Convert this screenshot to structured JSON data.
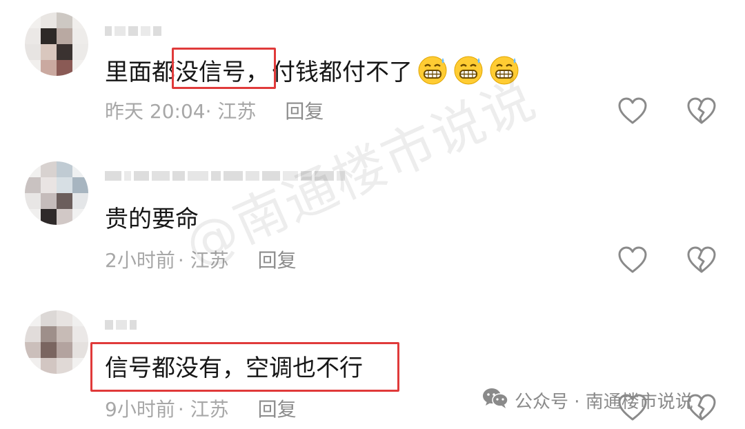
{
  "comments": [
    {
      "text_before": "里面都",
      "text_highlight": "没信号，",
      "text_after": "付钱都付不了",
      "emoji": [
        "grimacing-sweat-emoji",
        "grimacing-sweat-emoji",
        "grimacing-sweat-emoji"
      ],
      "time": "昨天 20:04",
      "location": "· 江苏",
      "reply": "回复"
    },
    {
      "text_before": "贵的要命",
      "time": "2小时前",
      "location": "· 江苏",
      "reply": "回复"
    },
    {
      "text_highlight": "信号都没有，空调也不行",
      "time": "9小时前",
      "location": "· 江苏",
      "reply": "回复"
    }
  ],
  "watermark": "@南通楼市说说",
  "source": {
    "icon": "wechat-icon",
    "label": "公众号 · 南通楼市说说"
  },
  "colors": {
    "highlight": "#e03a3a",
    "meta": "#a7a7a7",
    "text": "#161616",
    "icon": "#8a8a8a"
  }
}
